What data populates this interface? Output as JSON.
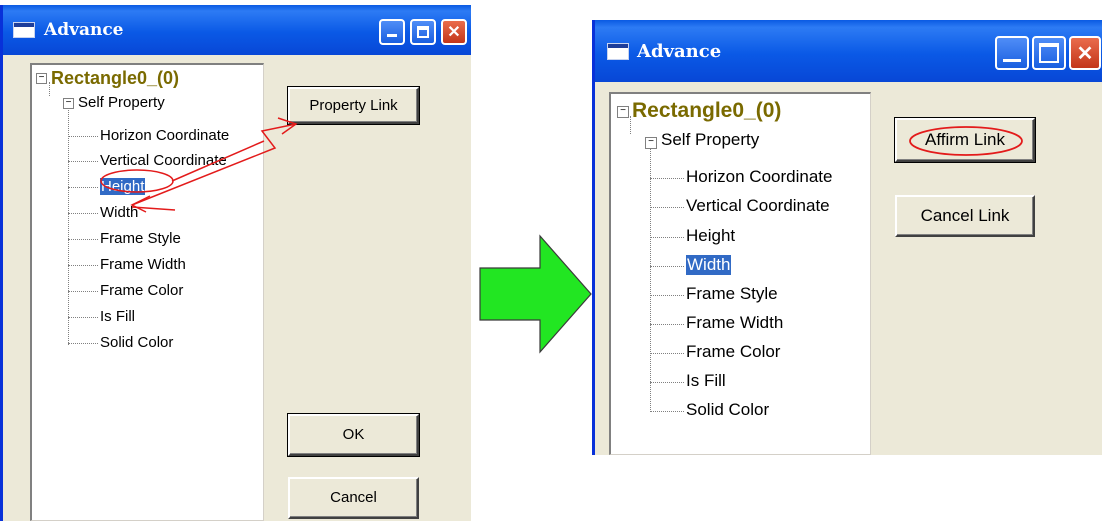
{
  "left_dialog": {
    "title": "Advance",
    "tree": {
      "root": "Rectangle0_(0)",
      "group": "Self Property",
      "items": [
        "Horizon Coordinate",
        "Vertical Coordinate",
        "Height",
        "Width",
        "Frame Style",
        "Frame Width",
        "Frame Color",
        "Is Fill",
        "Solid Color"
      ],
      "selected": "Height"
    },
    "buttons": {
      "property_link": "Property Link",
      "ok": "OK",
      "cancel": "Cancel"
    }
  },
  "right_dialog": {
    "title": "Advance",
    "tree": {
      "root": "Rectangle0_(0)",
      "group": "Self Property",
      "items": [
        "Horizon Coordinate",
        "Vertical Coordinate",
        "Height",
        "Width",
        "Frame Style",
        "Frame Width",
        "Frame Color",
        "Is Fill",
        "Solid Color"
      ],
      "selected": "Width"
    },
    "buttons": {
      "affirm_link": "Affirm Link",
      "cancel_link": "Cancel Link"
    }
  },
  "icons": {
    "window_icon": "window-icon",
    "minimize": "minimize-icon",
    "maximize": "maximize-icon",
    "close": "close-icon",
    "arrow": "right-arrow-icon"
  },
  "colors": {
    "titlebar": "#0a59e6",
    "window_bg": "#ece9d8",
    "selection": "#316ac5",
    "root_label": "#7a6a00",
    "annotation": "#e31b1b",
    "arrow_fill": "#22e622"
  }
}
